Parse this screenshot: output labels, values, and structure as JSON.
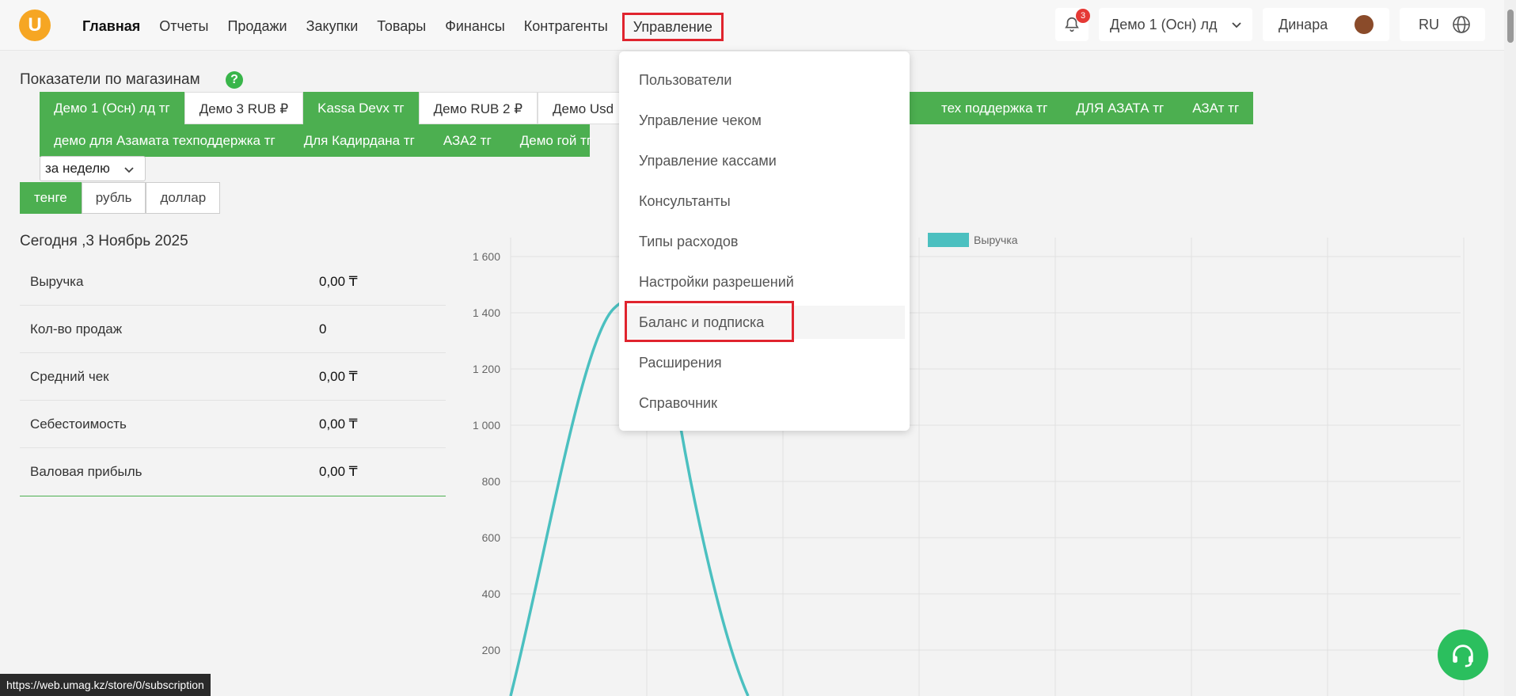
{
  "header": {
    "logo": "U",
    "nav": [
      "Главная",
      "Отчеты",
      "Продажи",
      "Закупки",
      "Товары",
      "Финансы",
      "Контрагенты",
      "Управление"
    ],
    "notification_count": "3",
    "store": "Демо 1 (Осн) лд",
    "user": "Динара",
    "lang": "RU"
  },
  "stores_section": {
    "title": "Показатели по магазинам",
    "row1": [
      "Демо 1 (Осн) лд тг",
      "Демо 3 RUB ₽",
      "Kassa Devx тг",
      "Демо RUB 2 ₽",
      "Демо Usd",
      "тех поддержка тг",
      "ДЛЯ АЗАТА тг",
      "АЗАт тг"
    ],
    "row2": [
      "демо для Азамата техподдержка тг",
      "Для Кадирдана тг",
      "АЗА2 тг",
      "Демо гой тг"
    ],
    "period": "за неделю",
    "currencies": [
      "тенге",
      "рубль",
      "доллар"
    ]
  },
  "today": {
    "title": "Сегодня ,3 Ноябрь 2025",
    "metrics": [
      {
        "label": "Выручка",
        "value": "0,00 ₸"
      },
      {
        "label": "Кол-во продаж",
        "value": "0"
      },
      {
        "label": "Средний чек",
        "value": "0,00 ₸"
      },
      {
        "label": "Себестоимость",
        "value": "0,00 ₸"
      },
      {
        "label": "Валовая прибыль",
        "value": "0,00 ₸"
      }
    ]
  },
  "dropdown": {
    "items": [
      "Пользователи",
      "Управление чеком",
      "Управление кассами",
      "Консультанты",
      "Типы расходов",
      "Настройки разрешений",
      "Баланс и подписка",
      "Расширения",
      "Справочник"
    ],
    "highlighted_index": 6
  },
  "chart_data": {
    "type": "line",
    "legend": [
      "Выручка"
    ],
    "y_ticks": [
      "1 600",
      "1 400",
      "1 200",
      "1 000",
      "800",
      "600",
      "400",
      "200"
    ],
    "ylim": [
      0,
      1600
    ],
    "series": [
      {
        "name": "Выручка",
        "color": "#4bc0c0"
      }
    ]
  },
  "status_bar": {
    "url": "https://web.umag.kz/store/0/subscription"
  },
  "colors": {
    "accent": "#4caf50",
    "highlight": "#e0242e",
    "line": "#4bc0c0"
  }
}
